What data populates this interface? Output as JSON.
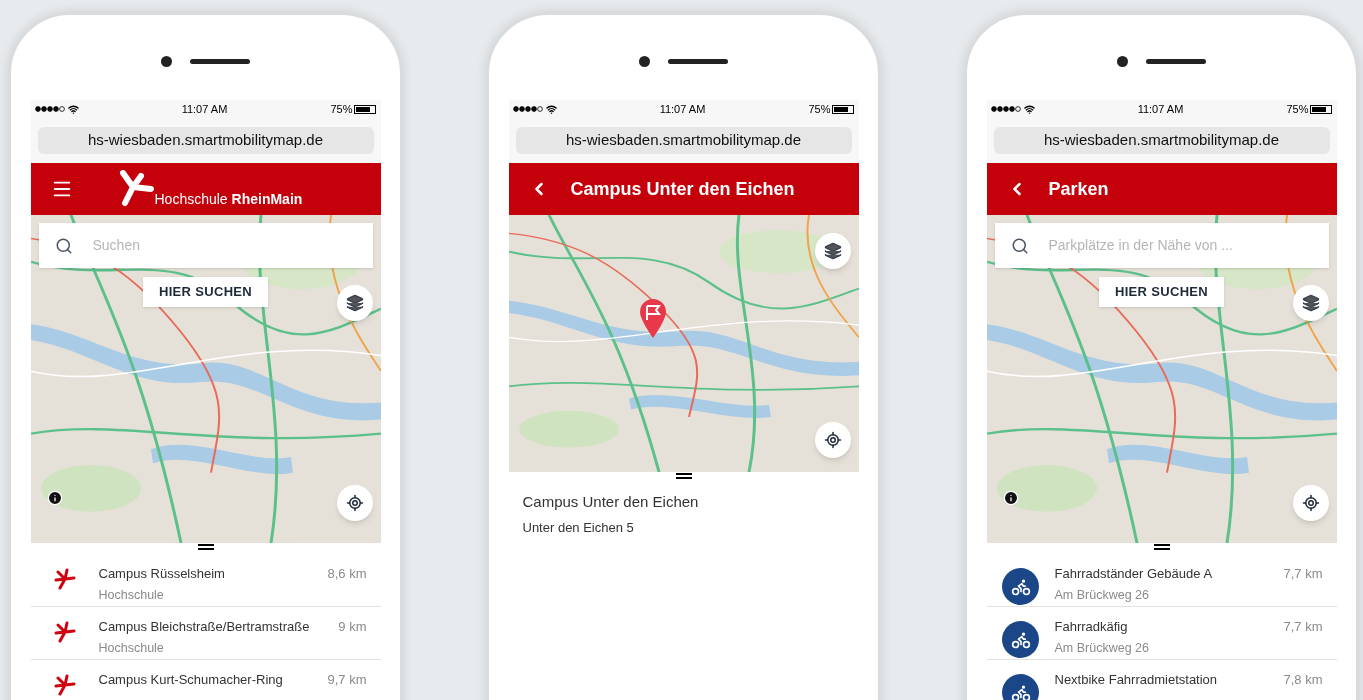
{
  "phones": [
    {
      "status": {
        "time": "11:07 AM",
        "battery": "75%"
      },
      "url": "hs-wiesbaden.smartmobilitymap.de",
      "header": {
        "kind": "logo",
        "title": "Hochschule **RheinMain**"
      },
      "map": {
        "search": {
          "placeholder": "Suchen"
        },
        "search_here": "HIER SUCHEN",
        "marker": false,
        "info": true
      },
      "sheet": {
        "kind": "list",
        "items": [
          {
            "kind": "campus",
            "title": "Campus Rüsselsheim",
            "subtitle": "Hochschule",
            "distance": "8,6 km"
          },
          {
            "kind": "campus",
            "title": "Campus Bleichstraße/Bertramstraße",
            "subtitle": "Hochschule",
            "distance": "9 km"
          },
          {
            "kind": "campus",
            "title": "Campus Kurt-Schumacher-Ring",
            "distance": "9,7 km"
          }
        ]
      }
    },
    {
      "status": {
        "time": "11:07 AM",
        "battery": "75%"
      },
      "url": "hs-wiesbaden.smartmobilitymap.de",
      "header": {
        "kind": "back",
        "title": "Campus Unter den Eichen"
      },
      "map": {
        "marker": true,
        "info": false
      },
      "sheet": {
        "kind": "detail",
        "title": "Campus Unter den Eichen",
        "address": "Unter den Eichen 5"
      }
    },
    {
      "status": {
        "time": "11:07 AM",
        "battery": "75%"
      },
      "url": "hs-wiesbaden.smartmobilitymap.de",
      "header": {
        "kind": "back",
        "title": "Parken"
      },
      "map": {
        "search": {
          "placeholder": "Parkplätze in der Nähe von ..."
        },
        "search_here": "HIER SUCHEN",
        "marker": false,
        "info": true
      },
      "sheet": {
        "kind": "list",
        "items": [
          {
            "kind": "bike",
            "title": "Fahrradständer Gebäude A",
            "subtitle": "Am Brückweg 26",
            "distance": "7,7 km"
          },
          {
            "kind": "bike",
            "title": "Fahrradkäfig",
            "subtitle": "Am Brückweg 26",
            "distance": "7,7 km"
          },
          {
            "kind": "bike",
            "title": "Nextbike Fahrradmietstation",
            "distance": "7,8 km"
          }
        ]
      }
    }
  ]
}
